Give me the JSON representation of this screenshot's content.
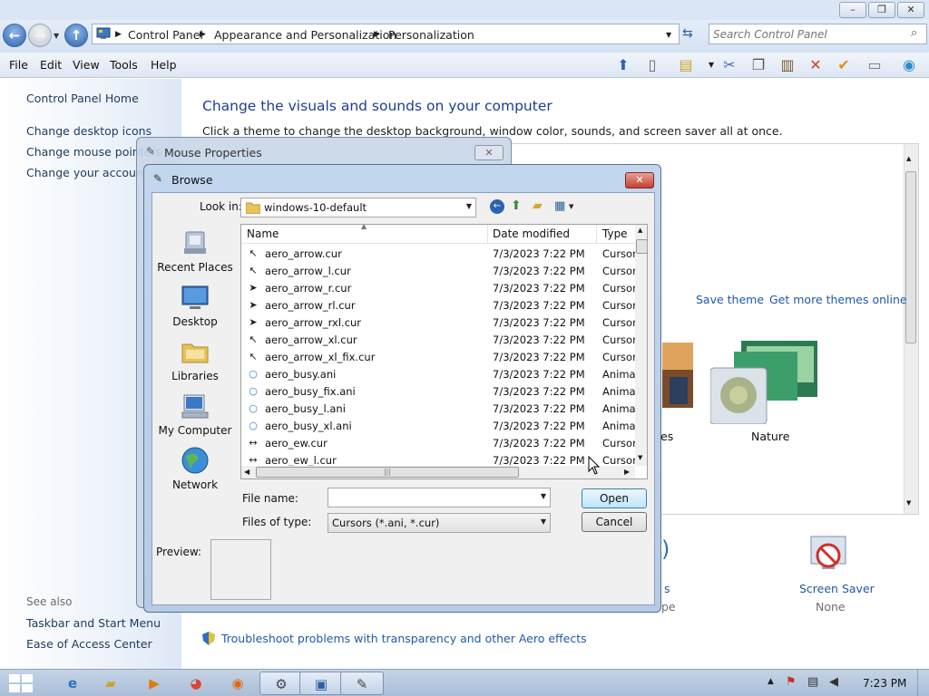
{
  "window": {
    "caption_buttons": {
      "minimize": "–",
      "maximize": "❐",
      "close": "✕"
    }
  },
  "navigation": {
    "breadcrumb": [
      "Control Panel",
      "Appearance and Personalization",
      "Personalization"
    ],
    "search_placeholder": "Search Control Panel"
  },
  "menu": [
    "File",
    "Edit",
    "View",
    "Tools",
    "Help"
  ],
  "left_pane": {
    "home": "Control Panel Home",
    "links": [
      "Change desktop icons",
      "Change mouse pointers",
      "Change your account picture"
    ],
    "see_also_title": "See also",
    "see_also": [
      "Taskbar and Start Menu",
      "Ease of Access Center"
    ]
  },
  "content": {
    "heading": "Change the visuals and sounds on your computer",
    "subtext": "Click a theme to change the desktop background, window color, sounds, and screen saver all at once.",
    "save_theme": "Save theme",
    "more_themes": "Get more themes online",
    "theme_partial_label": "es",
    "theme_nature": "Nature",
    "sounds_partial": "s",
    "sounds_partial_sub": "pe",
    "screen_saver_label": "Screen Saver",
    "screen_saver_value": "None",
    "troubleshoot": "Troubleshoot problems with transparency and other Aero effects"
  },
  "mouse_properties": {
    "title": "Mouse Properties"
  },
  "browse": {
    "title": "Browse",
    "look_in_label": "Look in:",
    "look_in_value": "windows-10-default",
    "places": [
      "Recent Places",
      "Desktop",
      "Libraries",
      "My Computer",
      "Network"
    ],
    "columns": {
      "name": "Name",
      "date": "Date modified",
      "type": "Type"
    },
    "files": [
      {
        "name": "aero_arrow.cur",
        "date": "7/3/2023 7:22 PM",
        "type": "Cursor",
        "icon": "arrow-cursor-icon"
      },
      {
        "name": "aero_arrow_l.cur",
        "date": "7/3/2023 7:22 PM",
        "type": "Cursor",
        "icon": "arrow-cursor-icon"
      },
      {
        "name": "aero_arrow_r.cur",
        "date": "7/3/2023 7:22 PM",
        "type": "Cursor",
        "icon": "arrow-cursor-icon"
      },
      {
        "name": "aero_arrow_rl.cur",
        "date": "7/3/2023 7:22 PM",
        "type": "Cursor",
        "icon": "arrow-cursor-icon"
      },
      {
        "name": "aero_arrow_rxl.cur",
        "date": "7/3/2023 7:22 PM",
        "type": "Cursor",
        "icon": "arrow-cursor-icon"
      },
      {
        "name": "aero_arrow_xl.cur",
        "date": "7/3/2023 7:22 PM",
        "type": "Cursor",
        "icon": "arrow-cursor-icon"
      },
      {
        "name": "aero_arrow_xl_fix.cur",
        "date": "7/3/2023 7:22 PM",
        "type": "Cursor",
        "icon": "arrow-cursor-icon"
      },
      {
        "name": "aero_busy.ani",
        "date": "7/3/2023 7:22 PM",
        "type": "Animated",
        "icon": "busy-ring-icon"
      },
      {
        "name": "aero_busy_fix.ani",
        "date": "7/3/2023 7:22 PM",
        "type": "Animated",
        "icon": "busy-ring-icon"
      },
      {
        "name": "aero_busy_l.ani",
        "date": "7/3/2023 7:22 PM",
        "type": "Animated",
        "icon": "busy-ring-icon"
      },
      {
        "name": "aero_busy_xl.ani",
        "date": "7/3/2023 7:22 PM",
        "type": "Animated",
        "icon": "busy-ring-icon"
      },
      {
        "name": "aero_ew.cur",
        "date": "7/3/2023 7:22 PM",
        "type": "Cursor",
        "icon": "resize-ew-icon"
      },
      {
        "name": "aero_ew_l.cur",
        "date": "7/3/2023 7:22 PM",
        "type": "Cursor",
        "icon": "resize-ew-icon"
      }
    ],
    "file_name_label": "File name:",
    "file_name_value": "",
    "files_of_type_label": "Files of type:",
    "files_of_type_value": "Cursors (*.ani, *.cur)",
    "open_button": "Open",
    "cancel_button": "Cancel",
    "preview_label": "Preview:"
  },
  "taskbar": {
    "clock": "7:23 PM"
  },
  "colors": {
    "link": "#1d3b5e",
    "heading": "#1e3d8f",
    "accent": "#3c7fb1",
    "close_red": "#c4412e"
  }
}
